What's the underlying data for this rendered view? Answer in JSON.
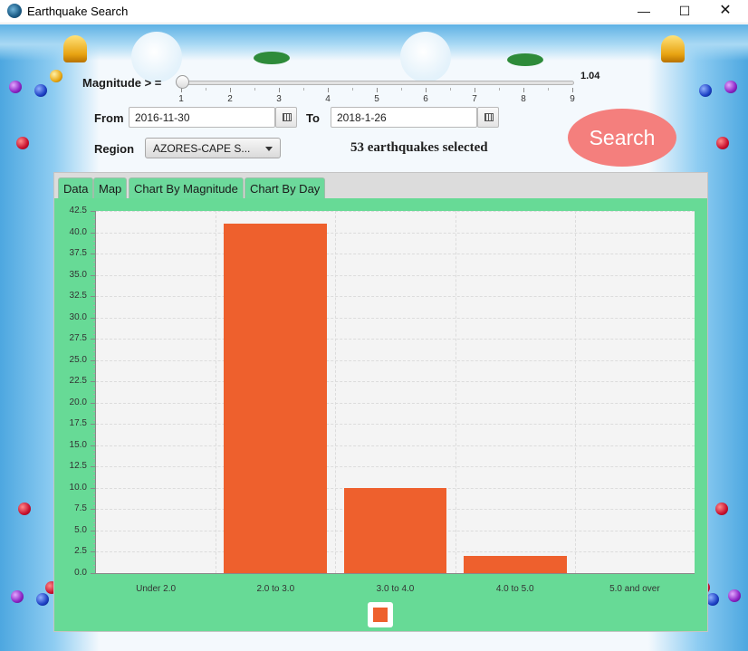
{
  "window": {
    "title": "Earthquake Search",
    "controls": {
      "minimize": "—",
      "maximize": "☐",
      "close": "✕"
    }
  },
  "form": {
    "magnitude_label": "Magnitude > =",
    "slider": {
      "ticks": [
        "1",
        "2",
        "3",
        "4",
        "5",
        "6",
        "7",
        "8",
        "9"
      ],
      "value": "1.04"
    },
    "from_label": "From",
    "from_date": "2016-11-30",
    "to_label": "To",
    "to_date": "2018-1-26",
    "region_label": "Region",
    "region_value": "AZORES-CAPE S...",
    "status": "53 earthquakes selected",
    "search_label": "Search"
  },
  "tabs": [
    {
      "label": "Data"
    },
    {
      "label": "Map"
    },
    {
      "label": "Chart By Magnitude",
      "selected": true
    },
    {
      "label": "Chart By Day"
    }
  ],
  "colors": {
    "bar": "#ee602d",
    "tab": "#6cd99b",
    "panel": "#67da96",
    "search": "#f47f7d"
  },
  "chart_data": {
    "type": "bar",
    "categories": [
      "Under 2.0",
      "2.0 to 3.0",
      "3.0 to 4.0",
      "4.0 to 5.0",
      "5.0 and over"
    ],
    "values": [
      0,
      41,
      10,
      2,
      0
    ],
    "ylim": [
      0,
      42.5
    ],
    "yticks": [
      "0.0",
      "2.5",
      "5.0",
      "7.5",
      "10.0",
      "12.5",
      "15.0",
      "17.5",
      "20.0",
      "22.5",
      "25.0",
      "27.5",
      "30.0",
      "32.5",
      "35.0",
      "37.5",
      "40.0",
      "42.5"
    ],
    "grid": true,
    "legend": "bottom-center"
  }
}
